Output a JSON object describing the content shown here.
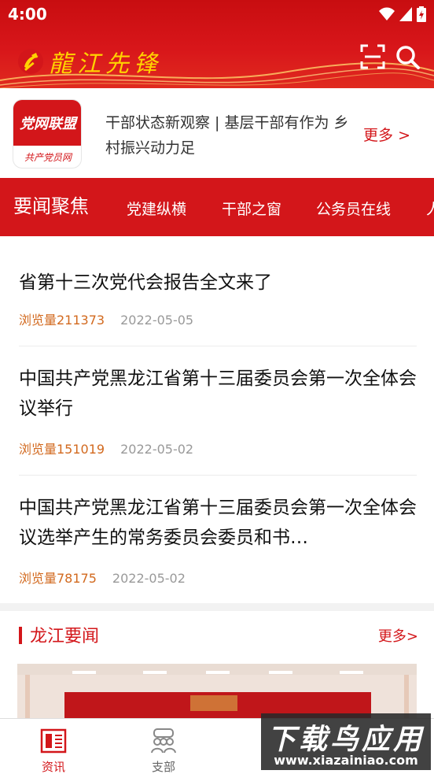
{
  "status_bar": {
    "time": "4:00"
  },
  "header": {
    "title": "龍江先锋",
    "icons": [
      "party-emblem-icon",
      "scan-icon",
      "search-icon"
    ],
    "brand_color": "#d3161a",
    "title_color": "#ffd200"
  },
  "banner": {
    "logo_text": "党网联盟",
    "logo_sub": "共产党员网",
    "text": "干部状态新观察 | 基层干部有作为 乡村振兴动力足",
    "more_label": "更多 >"
  },
  "tabs": [
    {
      "label": "要闻聚焦",
      "active": true
    },
    {
      "label": "党建纵横",
      "active": false
    },
    {
      "label": "干部之窗",
      "active": false
    },
    {
      "label": "公务员在线",
      "active": false
    },
    {
      "label": "人",
      "active": false
    }
  ],
  "news": [
    {
      "title": "省第十三次党代会报告全文来了",
      "views": "浏览量211373",
      "date": "2022-05-05"
    },
    {
      "title": "中国共产党黑龙江省第十三届委员会第一次全体会议举行",
      "views": "浏览量151019",
      "date": "2022-05-02"
    },
    {
      "title": "中国共产党黑龙江省第十三届委员会第一次全体会议选举产生的常务委员会委员和书…",
      "views": "浏览量78175",
      "date": "2022-05-02"
    }
  ],
  "section": {
    "title": "龙江要闻",
    "more_label": "更多>"
  },
  "bottom_nav": [
    {
      "label": "资讯",
      "icon": "news-icon",
      "active": true
    },
    {
      "label": "支部",
      "icon": "branch-icon",
      "active": false
    }
  ],
  "watermark": {
    "main": "下载鸟应用",
    "sub": "www.xiazainiao.com"
  }
}
